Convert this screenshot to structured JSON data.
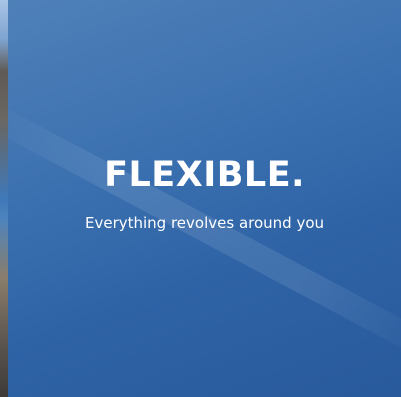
{
  "hero": {
    "headline": "FLEXIBLE.",
    "subheadline": "Everything revolves around you"
  },
  "colors": {
    "panel_blue": "#2e63a6",
    "text": "#ffffff"
  }
}
